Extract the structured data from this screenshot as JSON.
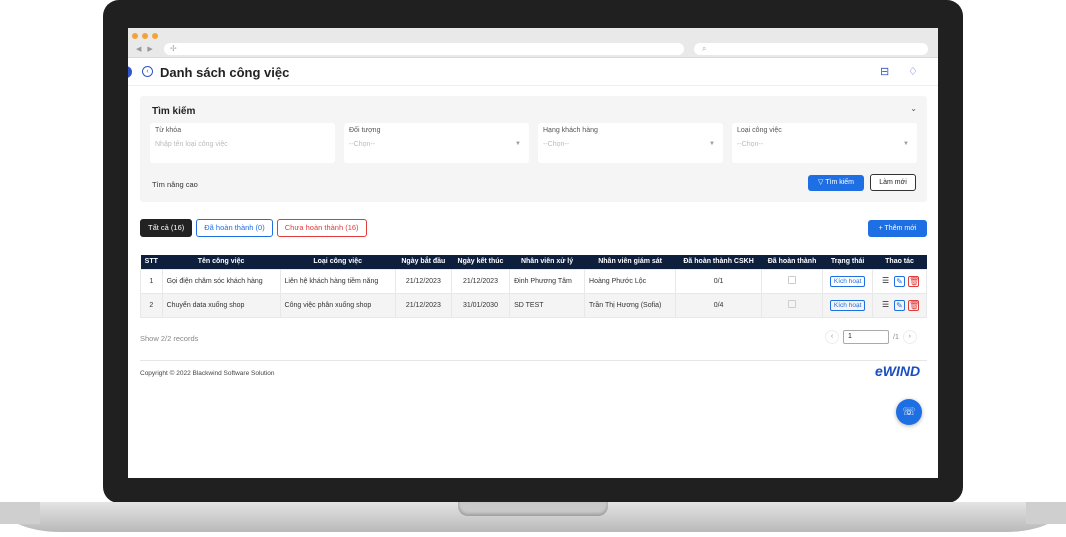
{
  "browser": {
    "nav_back": "◀",
    "nav_fwd": "▶",
    "url_prefix": "✢",
    "search_glyph": "⌕"
  },
  "page": {
    "title": "Danh sách công việc"
  },
  "search": {
    "title": "Tìm kiếm",
    "fields": [
      {
        "label": "Từ khóa",
        "placeholder": "Nhập tên loại công việc"
      },
      {
        "label": "Đối tượng",
        "placeholder": "--Chọn--"
      },
      {
        "label": "Hạng khách hàng",
        "placeholder": "--Chọn--"
      },
      {
        "label": "Loại công việc",
        "placeholder": "--Chọn--"
      }
    ],
    "advanced": "Tìm nâng cao",
    "search_button": "Tìm kiếm",
    "reset_button": "Làm mới"
  },
  "tabs": [
    {
      "label": "Tất cả (16)"
    },
    {
      "label": "Đã hoàn thành (0)"
    },
    {
      "label": "Chưa hoàn thành (16)"
    }
  ],
  "add_button": "+ Thêm mới",
  "table": {
    "headers": [
      "STT",
      "Tên công việc",
      "Loại công việc",
      "Ngày bắt đầu",
      "Ngày kết thúc",
      "Nhân viên xử lý",
      "Nhân viên giám sát",
      "Đã hoàn thành CSKH",
      "Đã hoàn thành",
      "Trạng thái",
      "Thao tác"
    ],
    "rows": [
      {
        "stt": "1",
        "name": "Gọi điện chăm sóc khách hàng",
        "type": "Liên hệ khách hàng tiềm năng",
        "start": "21/12/2023",
        "end": "21/12/2023",
        "handler": "Đinh Phương Tâm",
        "supervisor": "Hoàng Phước Lộc",
        "cskh": "0/1",
        "status": "Kích hoạt"
      },
      {
        "stt": "2",
        "name": "Chuyển data xuống shop",
        "type": "Công việc phân xuống shop",
        "start": "21/12/2023",
        "end": "31/01/2030",
        "handler": "SD TEST",
        "supervisor": "Trần Thị Hương (Sofia)",
        "cskh": "0/4",
        "status": "Kích hoạt"
      }
    ]
  },
  "footer": {
    "records": "Show 2/2 records",
    "page_value": "1",
    "page_total": "/1",
    "copyright": "Copyright © 2022 Blackwind Software Solution",
    "brand": "eWIND"
  }
}
